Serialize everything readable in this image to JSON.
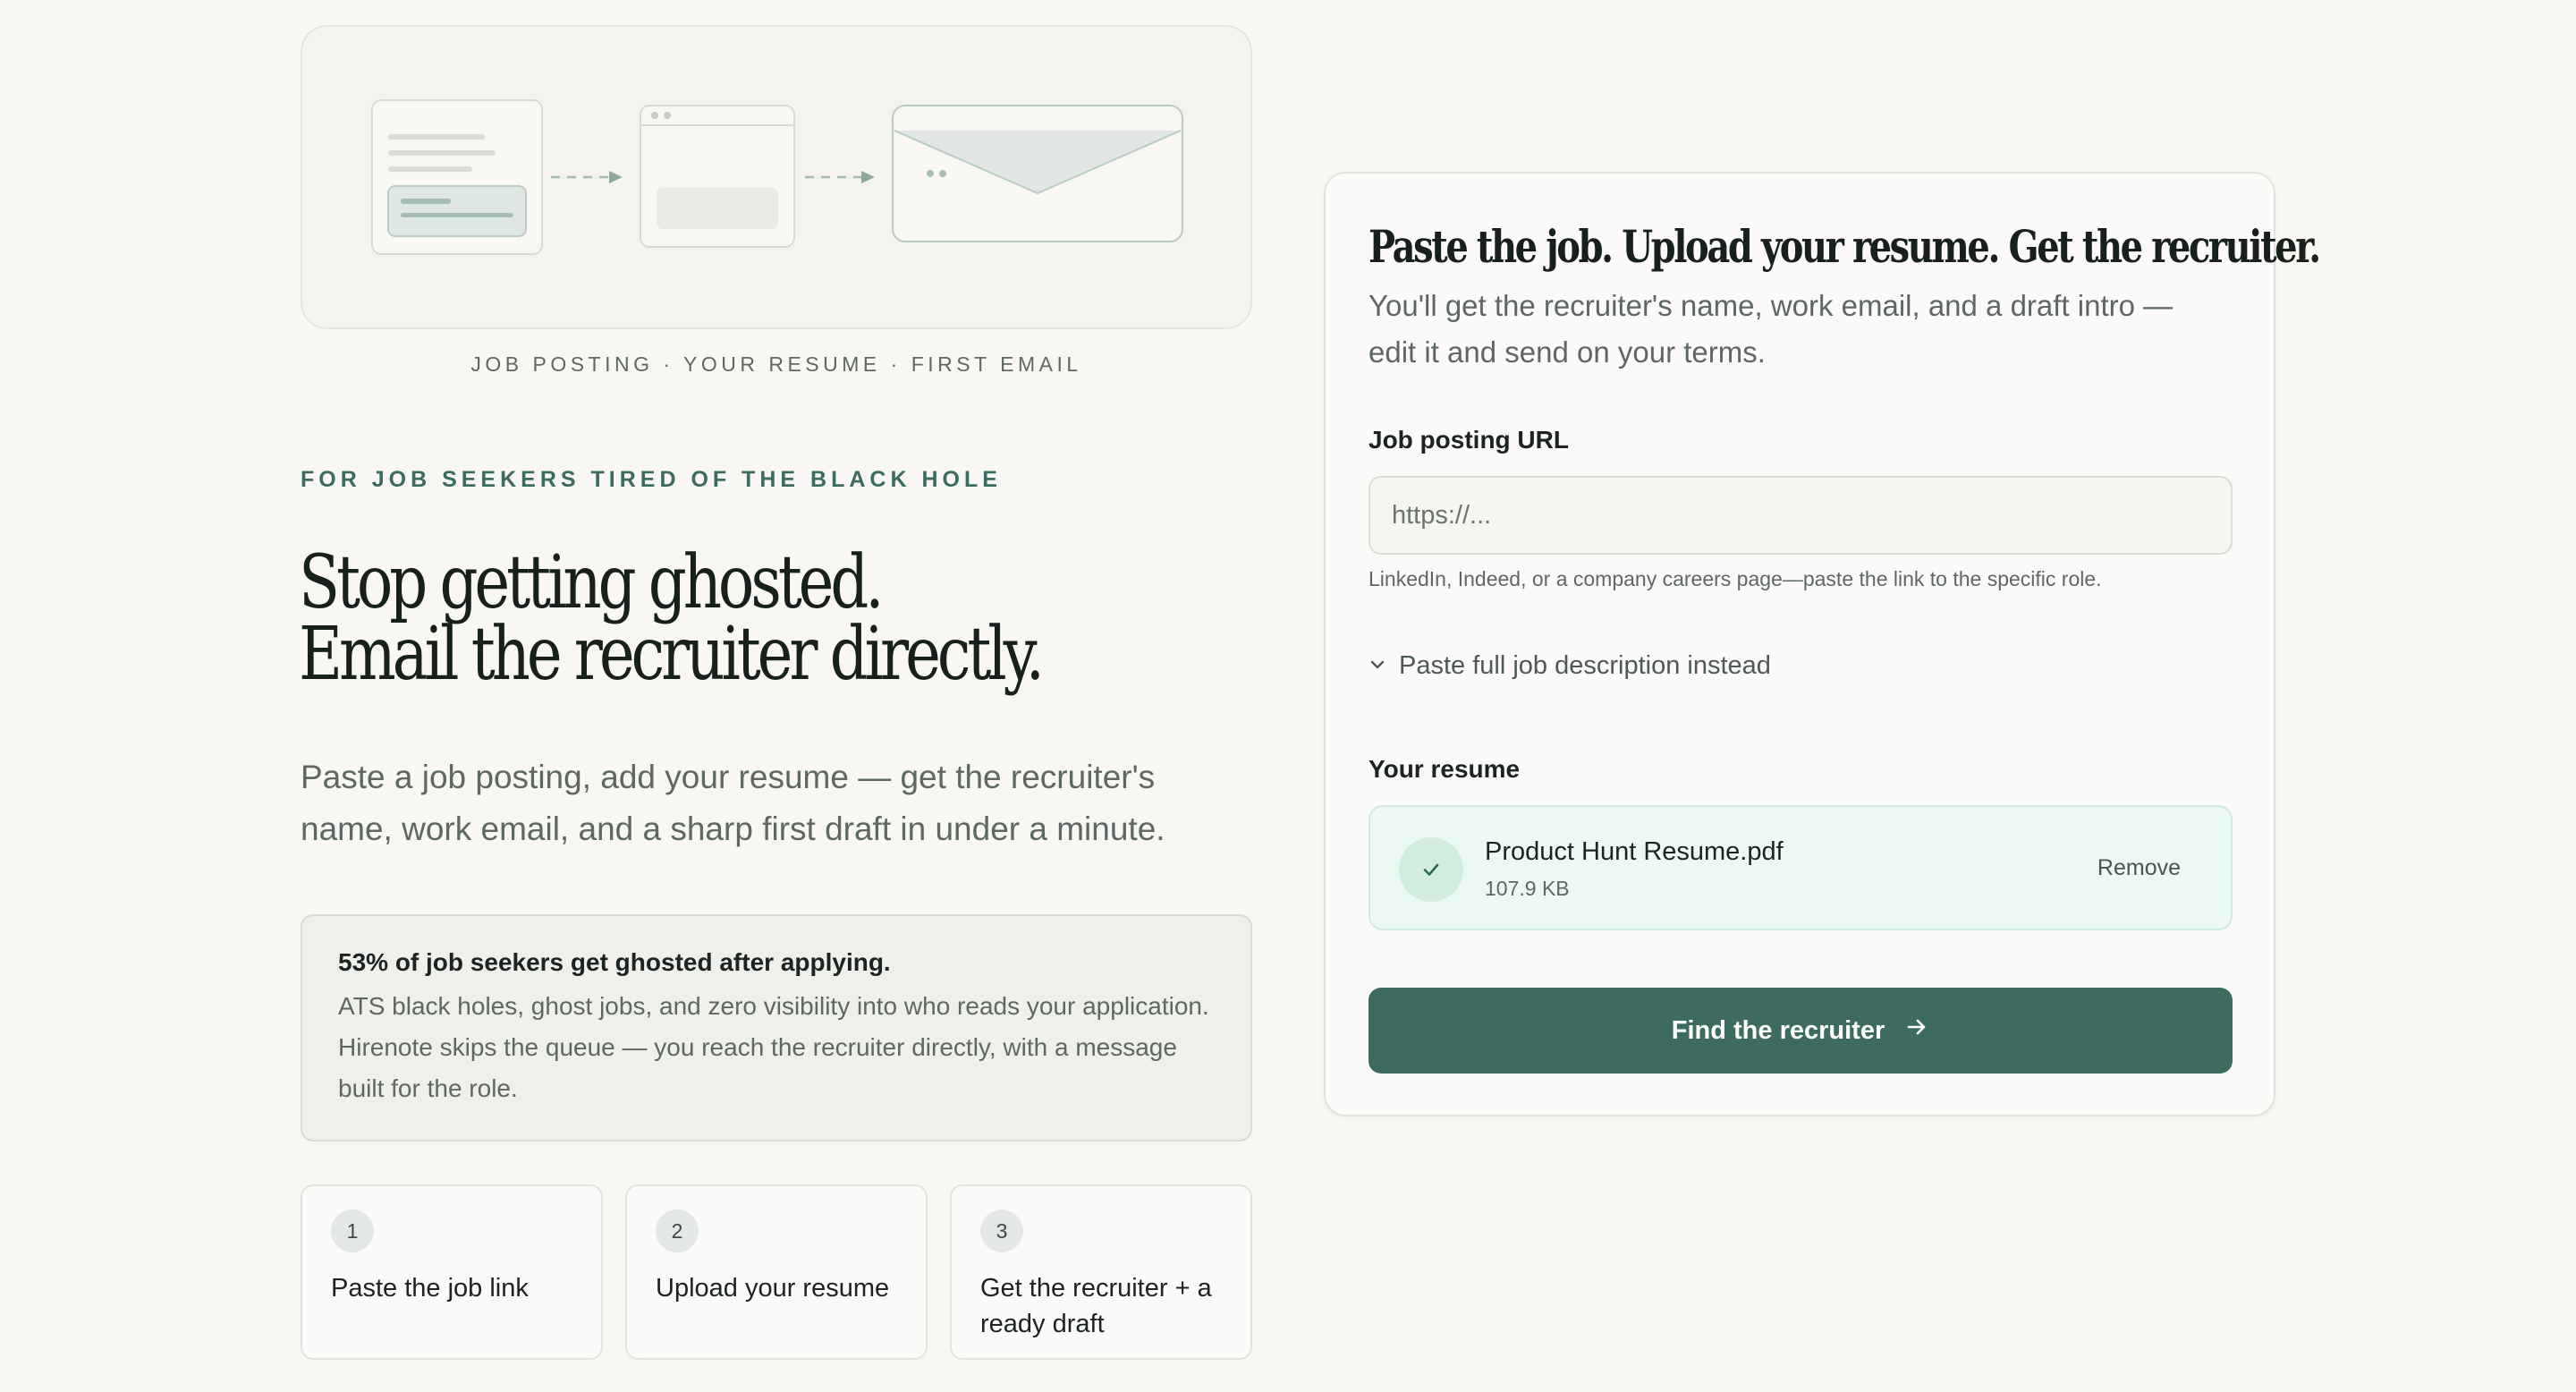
{
  "hero": {
    "illustration_caption": "JOB POSTING · YOUR RESUME · FIRST EMAIL",
    "eyebrow": "FOR JOB SEEKERS TIRED OF THE BLACK HOLE",
    "headline_line1": "Stop getting ghosted.",
    "headline_line2": "Email the recruiter directly.",
    "lede": "Paste a job posting, add your resume — get the recruiter's name, work email, and a sharp first draft in under a minute."
  },
  "stat": {
    "title": "53% of job seekers get ghosted after applying.",
    "body": "ATS black holes, ghost jobs, and zero visibility into who reads your application. Hirenote skips the queue — you reach the recruiter directly, with a message built for the role."
  },
  "steps": [
    {
      "number": "1",
      "label": "Paste the job link"
    },
    {
      "number": "2",
      "label": "Upload your resume"
    },
    {
      "number": "3",
      "label": "Get the recruiter + a ready draft"
    }
  ],
  "form": {
    "title": "Paste the job. Upload your resume. Get the recruiter.",
    "subtitle": "You'll get the recruiter's name, work email, and a draft intro — edit it and send on your terms.",
    "url_label": "Job posting URL",
    "url_placeholder": "https://...",
    "url_value": "",
    "url_hint": "LinkedIn, Indeed, or a company careers page—paste the link to the specific role.",
    "paste_toggle": "Paste full job description instead",
    "resume_label": "Your resume",
    "resume_file_name": "Product Hunt Resume.pdf",
    "resume_file_size": "107.9 KB",
    "remove_label": "Remove",
    "submit_label": "Find the recruiter"
  },
  "icons": {
    "toggle": "chevron-down-icon",
    "file_status": "check-icon",
    "submit": "arrow-right-icon"
  },
  "colors": {
    "accent": "#3e6b60",
    "eyebrow": "#3c6b5f",
    "success_bg": "#ecf8f2",
    "page_bg": "#f8f7f4"
  }
}
